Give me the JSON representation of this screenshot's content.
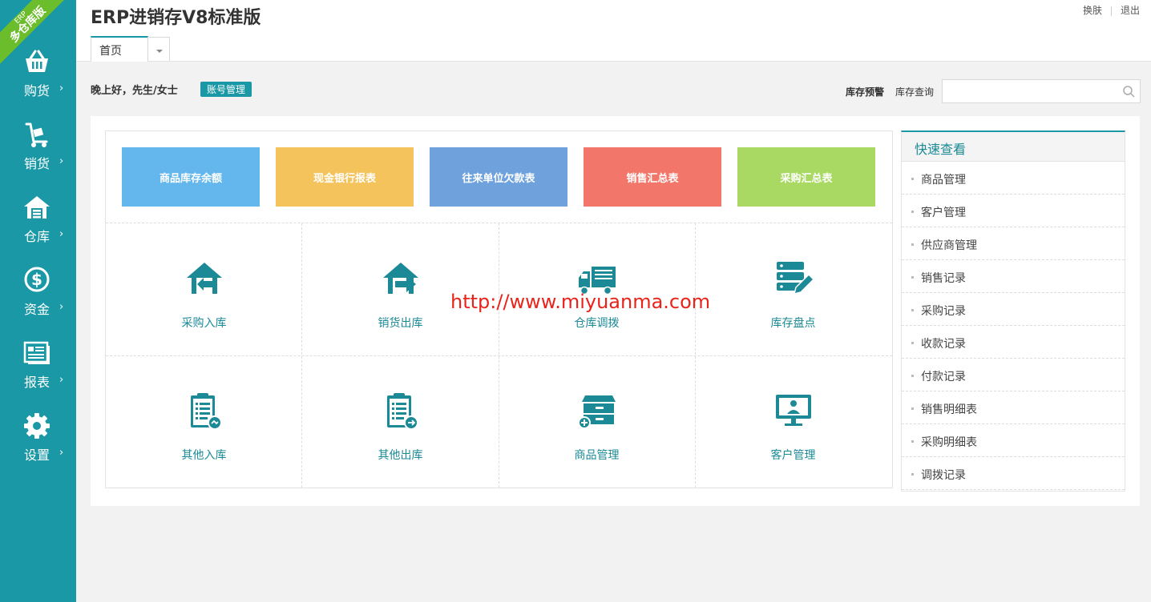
{
  "app": {
    "title": "ERP进销存V8标准版",
    "ribbon_small": "ERP",
    "ribbon_big": "多仓库版",
    "accent_color": "#1b98a6"
  },
  "top_links": {
    "skin": "换肤",
    "logout": "退出"
  },
  "tabs": {
    "home": "首页"
  },
  "sidebar": {
    "items": [
      {
        "label": "购货",
        "icon": "basket-icon"
      },
      {
        "label": "销货",
        "icon": "trolley-icon"
      },
      {
        "label": "仓库",
        "icon": "warehouse-icon"
      },
      {
        "label": "资金",
        "icon": "dollar-icon"
      },
      {
        "label": "报表",
        "icon": "report-icon"
      },
      {
        "label": "设置",
        "icon": "gear-icon"
      }
    ],
    "arrow": "›"
  },
  "greeting": {
    "text": "晚上好，先生/女士",
    "account_button": "账号管理"
  },
  "stock": {
    "warning": "库存预警",
    "query_label": "库存查询",
    "search_value": ""
  },
  "report_tiles": [
    {
      "label": "商品库存余额",
      "color": "#63b7ec"
    },
    {
      "label": "现金银行报表",
      "color": "#f4c35b"
    },
    {
      "label": "往来单位欠款表",
      "color": "#6fa1dd"
    },
    {
      "label": "销售汇总表",
      "color": "#f2776a"
    },
    {
      "label": "采购汇总表",
      "color": "#a9d962"
    }
  ],
  "quick_actions": [
    {
      "label": "采购入库",
      "icon": "house-in-icon"
    },
    {
      "label": "销货出库",
      "icon": "house-out-icon"
    },
    {
      "label": "仓库调拨",
      "icon": "truck-icon"
    },
    {
      "label": "库存盘点",
      "icon": "inventory-edit-icon"
    },
    {
      "label": "其他入库",
      "icon": "clipboard-in-icon"
    },
    {
      "label": "其他出库",
      "icon": "clipboard-out-icon"
    },
    {
      "label": "商品管理",
      "icon": "cabinet-icon"
    },
    {
      "label": "客户管理",
      "icon": "monitor-user-icon"
    }
  ],
  "quick_view": {
    "title": "快速查看",
    "items": [
      "商品管理",
      "客户管理",
      "供应商管理",
      "销售记录",
      "采购记录",
      "收款记录",
      "付款记录",
      "销售明细表",
      "采购明细表",
      "调拨记录"
    ]
  },
  "watermark": "http://www.miyuanma.com"
}
